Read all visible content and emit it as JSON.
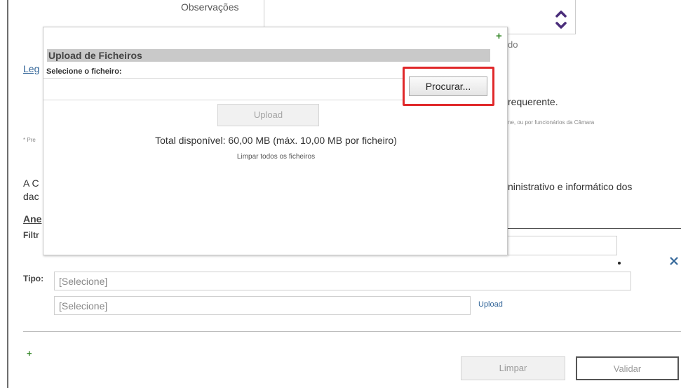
{
  "background": {
    "observacoes_label": "Observações",
    "ido_text": "do",
    "leg_text": "Leg",
    "requerente_text": "requerente.",
    "funcionarios_text": "ne, ou por funcionários da Câmara",
    "pre_text": "* Pre",
    "ac_text": "A C",
    "dac_text": "dac",
    "informatico_text": "ninistrativo e informático dos",
    "ane_text": "Ane",
    "filt_text": "Filtr",
    "tipo_label": "Tipo:",
    "tipo_select_value": "[Selecione]",
    "second_select_value": "[Selecione]",
    "upload_link": "Upload",
    "limpar_button": "Limpar",
    "validar_button": "Validar"
  },
  "modal": {
    "title": "Upload de Ficheiros",
    "file_label": "Selecione o ficheiro:",
    "browse_button": "Procurar...",
    "upload_button": "Upload",
    "total_text": "Total disponível: 60,00 MB (máx. 10,00 MB por ficheiro)",
    "clear_all_link": "Limpar todos os ficheiros"
  },
  "colors": {
    "highlight": "#e0282a",
    "accent_purple": "#4a2d7a",
    "link": "#336699",
    "plus_green": "#3a8a2e"
  }
}
